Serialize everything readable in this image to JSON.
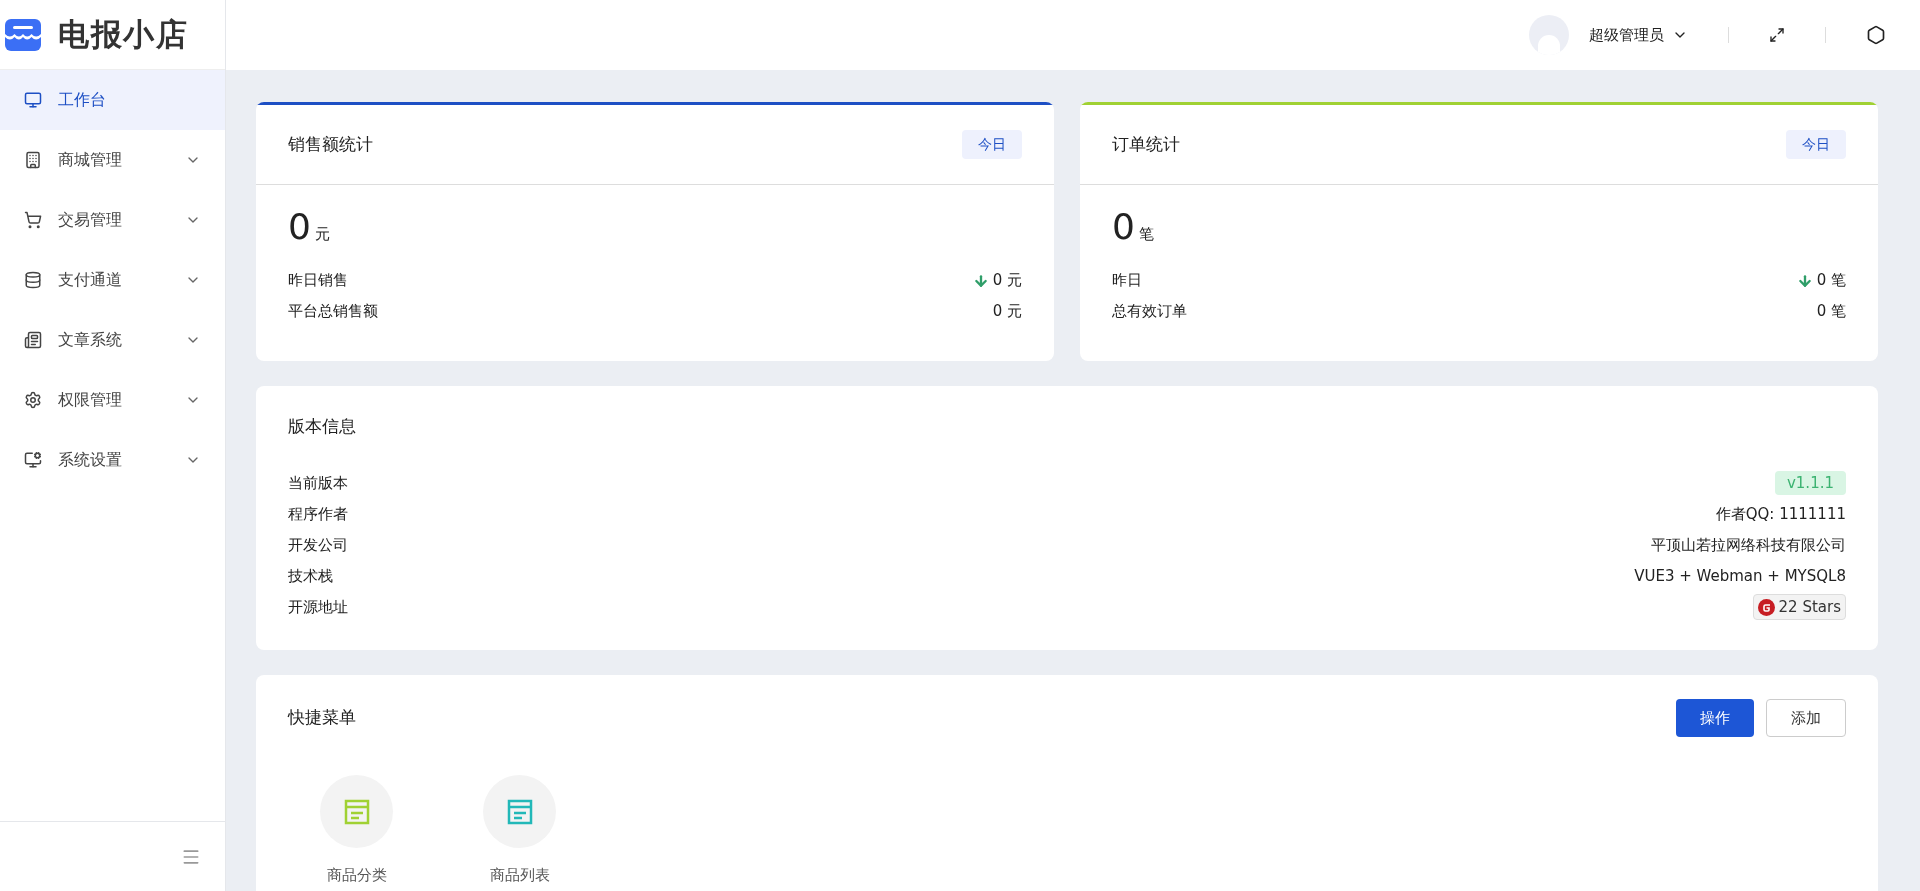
{
  "logo": {
    "text": "电报小店"
  },
  "sidebar": {
    "items": [
      {
        "label": "工作台",
        "selected": true,
        "expandable": false
      },
      {
        "label": "商城管理",
        "selected": false,
        "expandable": true
      },
      {
        "label": "交易管理",
        "selected": false,
        "expandable": true
      },
      {
        "label": "支付通道",
        "selected": false,
        "expandable": true
      },
      {
        "label": "文章系统",
        "selected": false,
        "expandable": true
      },
      {
        "label": "权限管理",
        "selected": false,
        "expandable": true
      },
      {
        "label": "系统设置",
        "selected": false,
        "expandable": true
      }
    ]
  },
  "header": {
    "user": "超级管理员"
  },
  "stat_cards": [
    {
      "title": "销售额统计",
      "color": "#1d4fc4",
      "tag": "今日",
      "value": "0",
      "unit": "元",
      "rows": [
        {
          "kind": "trend",
          "label": "昨日销售",
          "value": "0 元"
        },
        {
          "kind": "plain",
          "label": "平台总销售额",
          "value": "0 元"
        }
      ]
    },
    {
      "title": "订单统计",
      "color": "#a0d133",
      "tag": "今日",
      "value": "0",
      "unit": "笔",
      "rows": [
        {
          "kind": "trend",
          "label": "昨日",
          "value": "0 笔"
        },
        {
          "kind": "plain",
          "label": "总有效订单",
          "value": "0 笔"
        }
      ]
    }
  ],
  "version_card": {
    "title": "版本信息",
    "rows": [
      {
        "kind": "tag",
        "label": "当前版本",
        "value": "v1.1.1"
      },
      {
        "kind": "text",
        "label": "程序作者",
        "value": "作者QQ: 1111111"
      },
      {
        "kind": "text",
        "label": "开发公司",
        "value": "平顶山若拉网络科技有限公司"
      },
      {
        "kind": "text",
        "label": "技术栈",
        "value": "VUE3 + Webman + MYSQL8"
      },
      {
        "kind": "stars",
        "label": "开源地址",
        "value": "22 Stars"
      }
    ]
  },
  "quick_menu": {
    "title": "快捷菜单",
    "buttons": [
      {
        "kind": "primary",
        "label": "操作"
      },
      {
        "kind": "default",
        "label": "添加"
      }
    ],
    "items": [
      {
        "label": "商品分类",
        "color": "#a0d133"
      },
      {
        "label": "商品列表",
        "color": "#22b8b8"
      }
    ]
  }
}
